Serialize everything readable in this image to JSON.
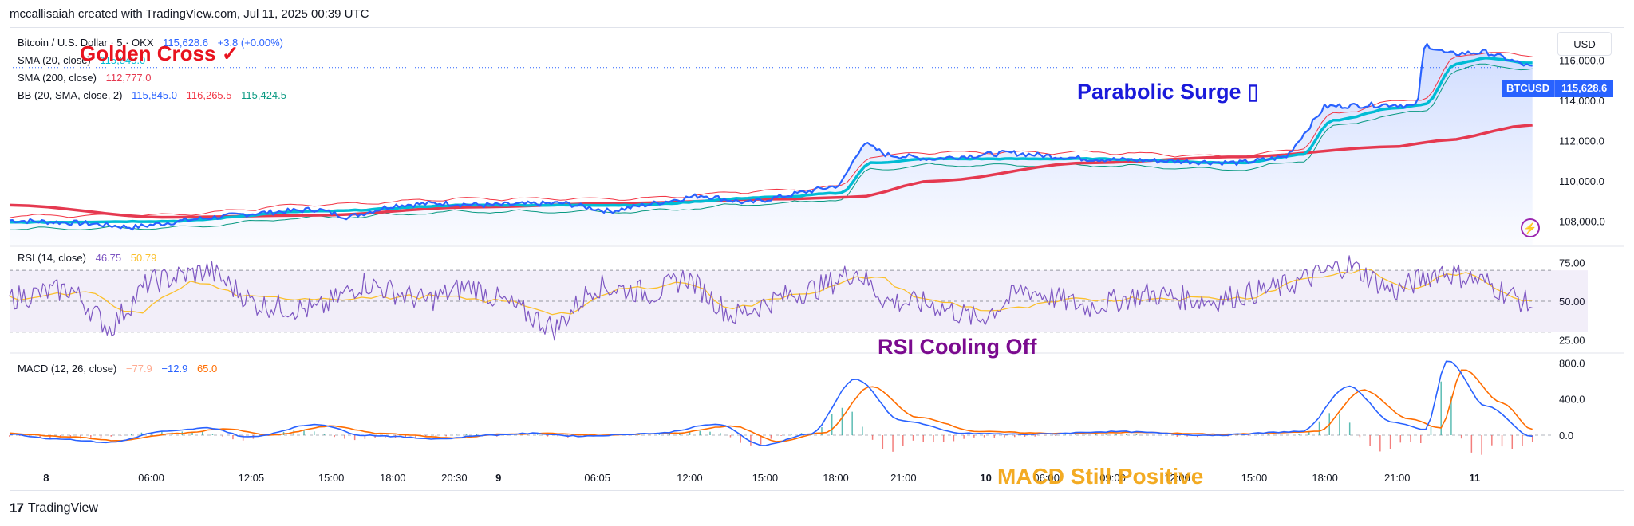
{
  "header": {
    "credit": "mccallisaiah created with TradingView.com, Jul 11, 2025 00:39 UTC"
  },
  "currency_button": "USD",
  "price_tag": {
    "symbol": "BTCUSD",
    "value": "115,628.6"
  },
  "legend": {
    "symbol": "Bitcoin / U.S. Dollar · 5 · OKX",
    "price": "115,628.6",
    "change": "+3.8 (+0.00%)",
    "sma20_label": "SMA (20, close)",
    "sma20_value": "115,845.0",
    "sma200_label": "SMA (200, close)",
    "sma200_value": "112,777.0",
    "bb_label": "BB (20, SMA, close, 2)",
    "bb_basis": "115,845.0",
    "bb_upper": "116,265.5",
    "bb_lower": "115,424.5",
    "rsi_label": "RSI (14, close)",
    "rsi_value": "46.75",
    "rsi_ma": "50.79",
    "macd_label": "MACD (12, 26, close)",
    "macd_hist": "−77.9",
    "macd_macd": "−12.9",
    "macd_signal": "65.0"
  },
  "annotations": {
    "golden_cross": "Golden Cross ✓",
    "parabolic": "Parabolic Surge ▯",
    "rsi_cooling": "RSI Cooling Off",
    "macd_positive": "MACD Still Positive"
  },
  "branding": {
    "logo_mark": "17",
    "logo_text": "TradingView"
  },
  "colors": {
    "price": "#2962ff",
    "sma20": "#00bcd4",
    "sma200": "#e53950",
    "bb_upper": "#f23645",
    "bb_lower": "#089981",
    "rsi": "#7e57c2",
    "rsi_ma": "#fbc02d",
    "macd": "#2962ff",
    "signal": "#ff6d00",
    "hist_pos": "#26a69a",
    "hist_neg": "#ef5350"
  },
  "chart_data": {
    "type": "line",
    "panels": [
      {
        "name": "price",
        "y_ticks": [
          "108,000.0",
          "110,000.0",
          "112,000.0",
          "114,000.0",
          "116,000.0"
        ],
        "y_tick_values": [
          108000,
          110000,
          112000,
          114000,
          116000
        ],
        "ylim": [
          106800,
          117400
        ]
      },
      {
        "name": "rsi",
        "y_ticks": [
          "25.00",
          "50.00",
          "75.00"
        ],
        "y_tick_values": [
          25,
          50,
          75
        ],
        "ylim": [
          17,
          85
        ],
        "band": [
          30,
          70
        ]
      },
      {
        "name": "macd",
        "y_ticks": [
          "0.0",
          "400.0",
          "800.0"
        ],
        "y_tick_values": [
          0,
          400,
          800
        ],
        "ylim": [
          -300,
          900
        ]
      }
    ],
    "x_ticks": [
      "8",
      "06:00",
      "12:05",
      "15:00",
      "18:00",
      "20:30",
      "9",
      "06:05",
      "12:00",
      "15:00",
      "18:00",
      "21:00",
      "10",
      "06:00",
      "09:00",
      "12:00",
      "15:00",
      "18:00",
      "21:00",
      "11"
    ],
    "x_tick_pos": [
      0.024,
      0.093,
      0.158,
      0.21,
      0.25,
      0.29,
      0.318,
      0.383,
      0.443,
      0.492,
      0.538,
      0.582,
      0.633,
      0.675,
      0.718,
      0.76,
      0.81,
      0.856,
      0.903,
      0.951
    ],
    "price_keys": [
      [
        0,
        108050
      ],
      [
        0.05,
        107900
      ],
      [
        0.08,
        107700
      ],
      [
        0.12,
        108100
      ],
      [
        0.16,
        108400
      ],
      [
        0.2,
        108600
      ],
      [
        0.22,
        108200
      ],
      [
        0.25,
        108800
      ],
      [
        0.28,
        108900
      ],
      [
        0.31,
        108800
      ],
      [
        0.36,
        108900
      ],
      [
        0.39,
        108500
      ],
      [
        0.42,
        108900
      ],
      [
        0.45,
        109300
      ],
      [
        0.48,
        108900
      ],
      [
        0.5,
        109200
      ],
      [
        0.54,
        109800
      ],
      [
        0.555,
        111900
      ],
      [
        0.57,
        111300
      ],
      [
        0.6,
        111100
      ],
      [
        0.65,
        111400
      ],
      [
        0.7,
        111100
      ],
      [
        0.75,
        111000
      ],
      [
        0.8,
        110900
      ],
      [
        0.83,
        111200
      ],
      [
        0.845,
        112700
      ],
      [
        0.855,
        113700
      ],
      [
        0.9,
        113800
      ],
      [
        0.915,
        113700
      ],
      [
        0.92,
        116800
      ],
      [
        0.935,
        116300
      ],
      [
        0.96,
        116400
      ],
      [
        0.99,
        115628
      ]
    ],
    "sma20_keys": [
      [
        0,
        107950
      ],
      [
        0.1,
        108000
      ],
      [
        0.2,
        108500
      ],
      [
        0.3,
        108800
      ],
      [
        0.4,
        108800
      ],
      [
        0.5,
        109200
      ],
      [
        0.54,
        109400
      ],
      [
        0.56,
        110900
      ],
      [
        0.6,
        111100
      ],
      [
        0.7,
        111100
      ],
      [
        0.8,
        110900
      ],
      [
        0.84,
        111300
      ],
      [
        0.86,
        113000
      ],
      [
        0.9,
        113600
      ],
      [
        0.92,
        113800
      ],
      [
        0.94,
        115800
      ],
      [
        0.96,
        116100
      ],
      [
        0.99,
        115845
      ]
    ],
    "sma200_keys": [
      [
        0,
        108800
      ],
      [
        0.1,
        108200
      ],
      [
        0.2,
        108300
      ],
      [
        0.3,
        108700
      ],
      [
        0.4,
        108900
      ],
      [
        0.5,
        109100
      ],
      [
        0.55,
        109200
      ],
      [
        0.6,
        110000
      ],
      [
        0.7,
        110900
      ],
      [
        0.8,
        111200
      ],
      [
        0.9,
        111700
      ],
      [
        0.93,
        112000
      ],
      [
        0.99,
        112777
      ]
    ],
    "rsi_keys": [
      [
        0,
        52
      ],
      [
        0.04,
        58
      ],
      [
        0.065,
        32
      ],
      [
        0.09,
        62
      ],
      [
        0.13,
        70
      ],
      [
        0.16,
        48
      ],
      [
        0.2,
        44
      ],
      [
        0.23,
        62
      ],
      [
        0.27,
        50
      ],
      [
        0.3,
        60
      ],
      [
        0.33,
        45
      ],
      [
        0.355,
        32
      ],
      [
        0.38,
        60
      ],
      [
        0.42,
        55
      ],
      [
        0.44,
        66
      ],
      [
        0.47,
        40
      ],
      [
        0.5,
        52
      ],
      [
        0.53,
        60
      ],
      [
        0.55,
        70
      ],
      [
        0.57,
        50
      ],
      [
        0.6,
        48
      ],
      [
        0.63,
        38
      ],
      [
        0.66,
        58
      ],
      [
        0.7,
        46
      ],
      [
        0.74,
        55
      ],
      [
        0.78,
        50
      ],
      [
        0.83,
        60
      ],
      [
        0.87,
        74
      ],
      [
        0.9,
        56
      ],
      [
        0.93,
        70
      ],
      [
        0.96,
        62
      ],
      [
        0.99,
        46.75
      ]
    ],
    "rsi_ma_keys": [
      [
        0,
        52
      ],
      [
        0.05,
        55
      ],
      [
        0.08,
        42
      ],
      [
        0.12,
        62
      ],
      [
        0.16,
        52
      ],
      [
        0.22,
        52
      ],
      [
        0.27,
        53
      ],
      [
        0.32,
        50
      ],
      [
        0.36,
        42
      ],
      [
        0.4,
        58
      ],
      [
        0.44,
        62
      ],
      [
        0.47,
        46
      ],
      [
        0.52,
        56
      ],
      [
        0.56,
        66
      ],
      [
        0.6,
        50
      ],
      [
        0.64,
        44
      ],
      [
        0.7,
        51
      ],
      [
        0.75,
        52
      ],
      [
        0.8,
        52
      ],
      [
        0.85,
        66
      ],
      [
        0.88,
        70
      ],
      [
        0.91,
        58
      ],
      [
        0.94,
        68
      ],
      [
        0.99,
        50.79
      ]
    ],
    "macd_keys": [
      [
        0,
        10
      ],
      [
        0.03,
        -40
      ],
      [
        0.065,
        -80
      ],
      [
        0.1,
        40
      ],
      [
        0.13,
        80
      ],
      [
        0.155,
        -20
      ],
      [
        0.2,
        120
      ],
      [
        0.23,
        0
      ],
      [
        0.28,
        -40
      ],
      [
        0.31,
        0
      ],
      [
        0.34,
        20
      ],
      [
        0.37,
        -10
      ],
      [
        0.42,
        20
      ],
      [
        0.46,
        120
      ],
      [
        0.49,
        -110
      ],
      [
        0.52,
        10
      ],
      [
        0.55,
        620
      ],
      [
        0.58,
        160
      ],
      [
        0.62,
        20
      ],
      [
        0.66,
        10
      ],
      [
        0.72,
        40
      ],
      [
        0.78,
        0
      ],
      [
        0.84,
        40
      ],
      [
        0.87,
        540
      ],
      [
        0.9,
        140
      ],
      [
        0.92,
        60
      ],
      [
        0.935,
        830
      ],
      [
        0.96,
        320
      ],
      [
        0.99,
        -12.9
      ]
    ],
    "signal_keys": [
      [
        0,
        20
      ],
      [
        0.04,
        -20
      ],
      [
        0.07,
        -60
      ],
      [
        0.11,
        20
      ],
      [
        0.14,
        70
      ],
      [
        0.17,
        0
      ],
      [
        0.21,
        100
      ],
      [
        0.24,
        20
      ],
      [
        0.29,
        -30
      ],
      [
        0.32,
        10
      ],
      [
        0.35,
        20
      ],
      [
        0.38,
        0
      ],
      [
        0.43,
        20
      ],
      [
        0.47,
        100
      ],
      [
        0.5,
        -70
      ],
      [
        0.53,
        30
      ],
      [
        0.56,
        540
      ],
      [
        0.59,
        200
      ],
      [
        0.63,
        40
      ],
      [
        0.68,
        20
      ],
      [
        0.73,
        30
      ],
      [
        0.79,
        10
      ],
      [
        0.85,
        40
      ],
      [
        0.88,
        500
      ],
      [
        0.91,
        180
      ],
      [
        0.93,
        80
      ],
      [
        0.945,
        730
      ],
      [
        0.97,
        360
      ],
      [
        0.99,
        65.0
      ]
    ]
  }
}
